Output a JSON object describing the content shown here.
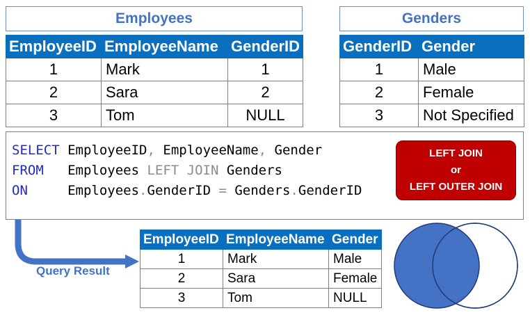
{
  "employees": {
    "title": "Employees",
    "headers": [
      "EmployeeID",
      "EmployeeName",
      "GenderID"
    ],
    "rows": [
      [
        "1",
        "Mark",
        "1"
      ],
      [
        "2",
        "Sara",
        "2"
      ],
      [
        "3",
        "Tom",
        "NULL"
      ]
    ]
  },
  "genders": {
    "title": "Genders",
    "headers": [
      "GenderID",
      "Gender"
    ],
    "rows": [
      [
        "1",
        "Male"
      ],
      [
        "2",
        "Female"
      ],
      [
        "3",
        "Not Specified"
      ]
    ]
  },
  "query": {
    "line1": {
      "kw": "SELECT",
      "rest_a": " EmployeeID",
      "sep1": ",",
      "rest_b": " EmployeeName",
      "sep2": ",",
      "rest_c": " Gender"
    },
    "line2": {
      "kw": "FROM",
      "rest_a": "   Employees ",
      "join": "LEFT JOIN",
      "rest_b": " Genders"
    },
    "line3": {
      "kw": "ON",
      "rest_a": "     Employees",
      "dot1": ".",
      "rest_b": "GenderID ",
      "eq": "=",
      "rest_c": " Genders",
      "dot2": ".",
      "rest_d": "GenderID"
    }
  },
  "join_badge": {
    "line1": "LEFT JOIN",
    "line2": "or",
    "line3": "LEFT OUTER JOIN"
  },
  "result": {
    "label": "Query Result",
    "headers": [
      "EmployeeID",
      "EmployeeName",
      "Gender"
    ],
    "rows": [
      [
        "1",
        "Mark",
        "Male"
      ],
      [
        "2",
        "Sara",
        "Female"
      ],
      [
        "3",
        "Tom",
        "NULL"
      ]
    ]
  },
  "colors": {
    "header_blue": "#0b6fbf",
    "title_blue": "#4472c4",
    "badge_red": "#c00000",
    "venn_fill": "#4472c4"
  }
}
